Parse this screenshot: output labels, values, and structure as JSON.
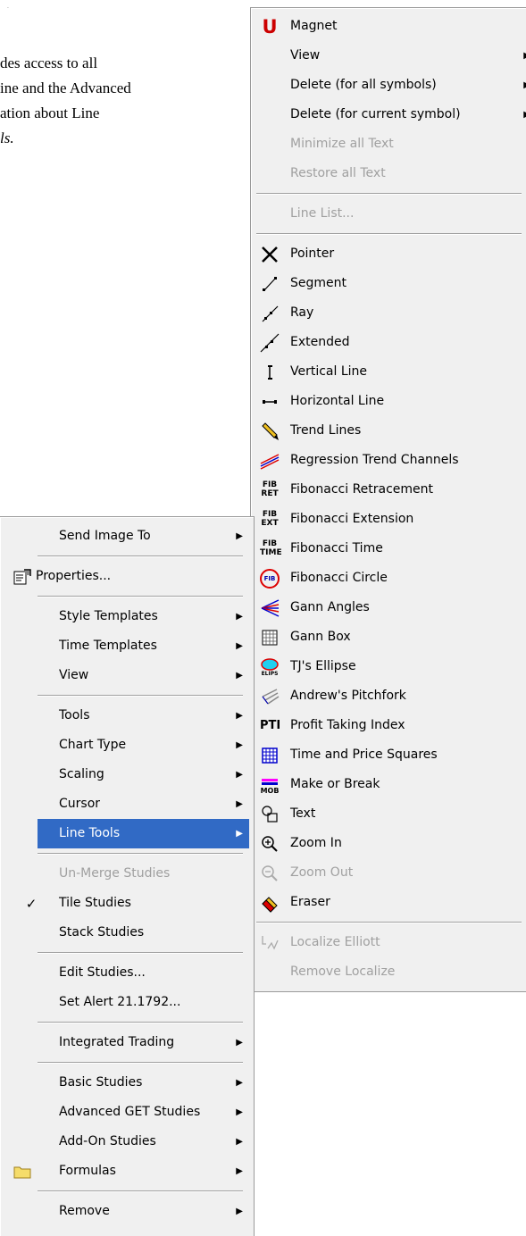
{
  "document": {
    "lines": [
      "des access to all",
      "ine and the Advanced",
      "ation about Line",
      "ls."
    ],
    "corner_mark": "·"
  },
  "line_tools_menu": {
    "items": [
      {
        "label": "Magnet",
        "icon": "magnet-icon",
        "disabled": false,
        "submenu": false
      },
      {
        "label": "View",
        "icon": null,
        "disabled": false,
        "submenu": true
      },
      {
        "label": "Delete (for all symbols)",
        "icon": null,
        "disabled": false,
        "submenu": true
      },
      {
        "label": "Delete (for current symbol)",
        "icon": null,
        "disabled": false,
        "submenu": true
      },
      {
        "label": "Minimize all Text",
        "icon": null,
        "disabled": true,
        "submenu": false
      },
      {
        "label": "Restore all Text",
        "icon": null,
        "disabled": true,
        "submenu": false
      },
      {
        "sep": true
      },
      {
        "label": "Line List...",
        "icon": null,
        "disabled": true,
        "submenu": false
      },
      {
        "sep": true
      },
      {
        "label": "Pointer",
        "icon": "pointer-icon",
        "disabled": false
      },
      {
        "label": "Segment",
        "icon": "segment-icon",
        "disabled": false
      },
      {
        "label": "Ray",
        "icon": "ray-icon",
        "disabled": false
      },
      {
        "label": "Extended",
        "icon": "extended-line-icon",
        "disabled": false
      },
      {
        "label": "Vertical Line",
        "icon": "vertical-line-icon",
        "disabled": false
      },
      {
        "label": "Horizontal Line",
        "icon": "horizontal-line-icon",
        "disabled": false
      },
      {
        "label": "Trend Lines",
        "icon": "pencil-icon",
        "disabled": false
      },
      {
        "label": "Regression Trend Channels",
        "icon": "regression-channel-icon",
        "disabled": false
      },
      {
        "label": "Fibonacci Retracement",
        "icon": "fib-ret-icon",
        "disabled": false
      },
      {
        "label": "Fibonacci Extension",
        "icon": "fib-ext-icon",
        "disabled": false
      },
      {
        "label": "Fibonacci Time",
        "icon": "fib-time-icon",
        "disabled": false
      },
      {
        "label": "Fibonacci Circle",
        "icon": "fib-circle-icon",
        "disabled": false
      },
      {
        "label": "Gann Angles",
        "icon": "gann-angles-icon",
        "disabled": false
      },
      {
        "label": "Gann Box",
        "icon": "gann-box-icon",
        "disabled": false
      },
      {
        "label": "TJ's Ellipse",
        "icon": "ellipse-icon",
        "disabled": false
      },
      {
        "label": "Andrew's Pitchfork",
        "icon": "pitchfork-icon",
        "disabled": false
      },
      {
        "label": "Profit Taking Index",
        "icon": "pti-icon",
        "disabled": false
      },
      {
        "label": "Time and Price Squares",
        "icon": "price-squares-icon",
        "disabled": false
      },
      {
        "label": "Make or Break",
        "icon": "mob-icon",
        "disabled": false
      },
      {
        "label": "Text",
        "icon": "text-tool-icon",
        "disabled": false
      },
      {
        "label": "Zoom In",
        "icon": "zoom-in-icon",
        "disabled": false
      },
      {
        "label": "Zoom Out",
        "icon": "zoom-out-icon",
        "disabled": true
      },
      {
        "label": "Eraser",
        "icon": "eraser-icon",
        "disabled": false
      },
      {
        "sep": true
      },
      {
        "label": "Localize Elliott",
        "icon": "elliott-icon",
        "disabled": true
      },
      {
        "label": "Remove Localize",
        "icon": null,
        "disabled": true
      }
    ],
    "icon_text": {
      "magnet": "U",
      "fib_ret": [
        "FIB",
        "RET"
      ],
      "fib_ext": [
        "FIB",
        "EXT"
      ],
      "fib_time": [
        "FIB",
        "TIME"
      ],
      "fib_circle": "FIB",
      "ellipse": "ELIPS",
      "pti": "PTI",
      "mob": "MOB"
    }
  },
  "context_menu": {
    "items": [
      {
        "label": "Send Image To",
        "submenu": true
      },
      {
        "sep": true
      },
      {
        "label": "Properties...",
        "icon": "properties-icon"
      },
      {
        "sep": true
      },
      {
        "label": "Style Templates",
        "submenu": true
      },
      {
        "label": "Time Templates",
        "submenu": true
      },
      {
        "label": "View",
        "submenu": true
      },
      {
        "sep": true
      },
      {
        "label": "Tools",
        "submenu": true
      },
      {
        "label": "Chart Type",
        "submenu": true
      },
      {
        "label": "Scaling",
        "submenu": true
      },
      {
        "label": "Cursor",
        "submenu": true
      },
      {
        "label": "Line Tools",
        "submenu": true,
        "highlighted": true
      },
      {
        "sep": true
      },
      {
        "label": "Un-Merge Studies",
        "disabled": true
      },
      {
        "label": "Tile Studies",
        "checked": true
      },
      {
        "label": "Stack Studies"
      },
      {
        "sep": true
      },
      {
        "label": "Edit Studies..."
      },
      {
        "label": "Set Alert 21.1792..."
      },
      {
        "sep": true
      },
      {
        "label": "Integrated Trading",
        "submenu": true
      },
      {
        "sep": true
      },
      {
        "label": "Basic Studies",
        "submenu": true
      },
      {
        "label": "Advanced GET Studies",
        "submenu": true
      },
      {
        "label": "Add-On Studies",
        "submenu": true
      },
      {
        "label": "Formulas",
        "submenu": true,
        "icon": "folder-icon"
      },
      {
        "sep": true
      },
      {
        "label": "Remove",
        "submenu": true
      }
    ],
    "checkmark": "✓"
  },
  "colors": {
    "highlight": "#316ac5",
    "menu_bg": "#f0f0f0",
    "disabled_text": "#a0a0a0",
    "magnet_red": "#cc0000"
  }
}
